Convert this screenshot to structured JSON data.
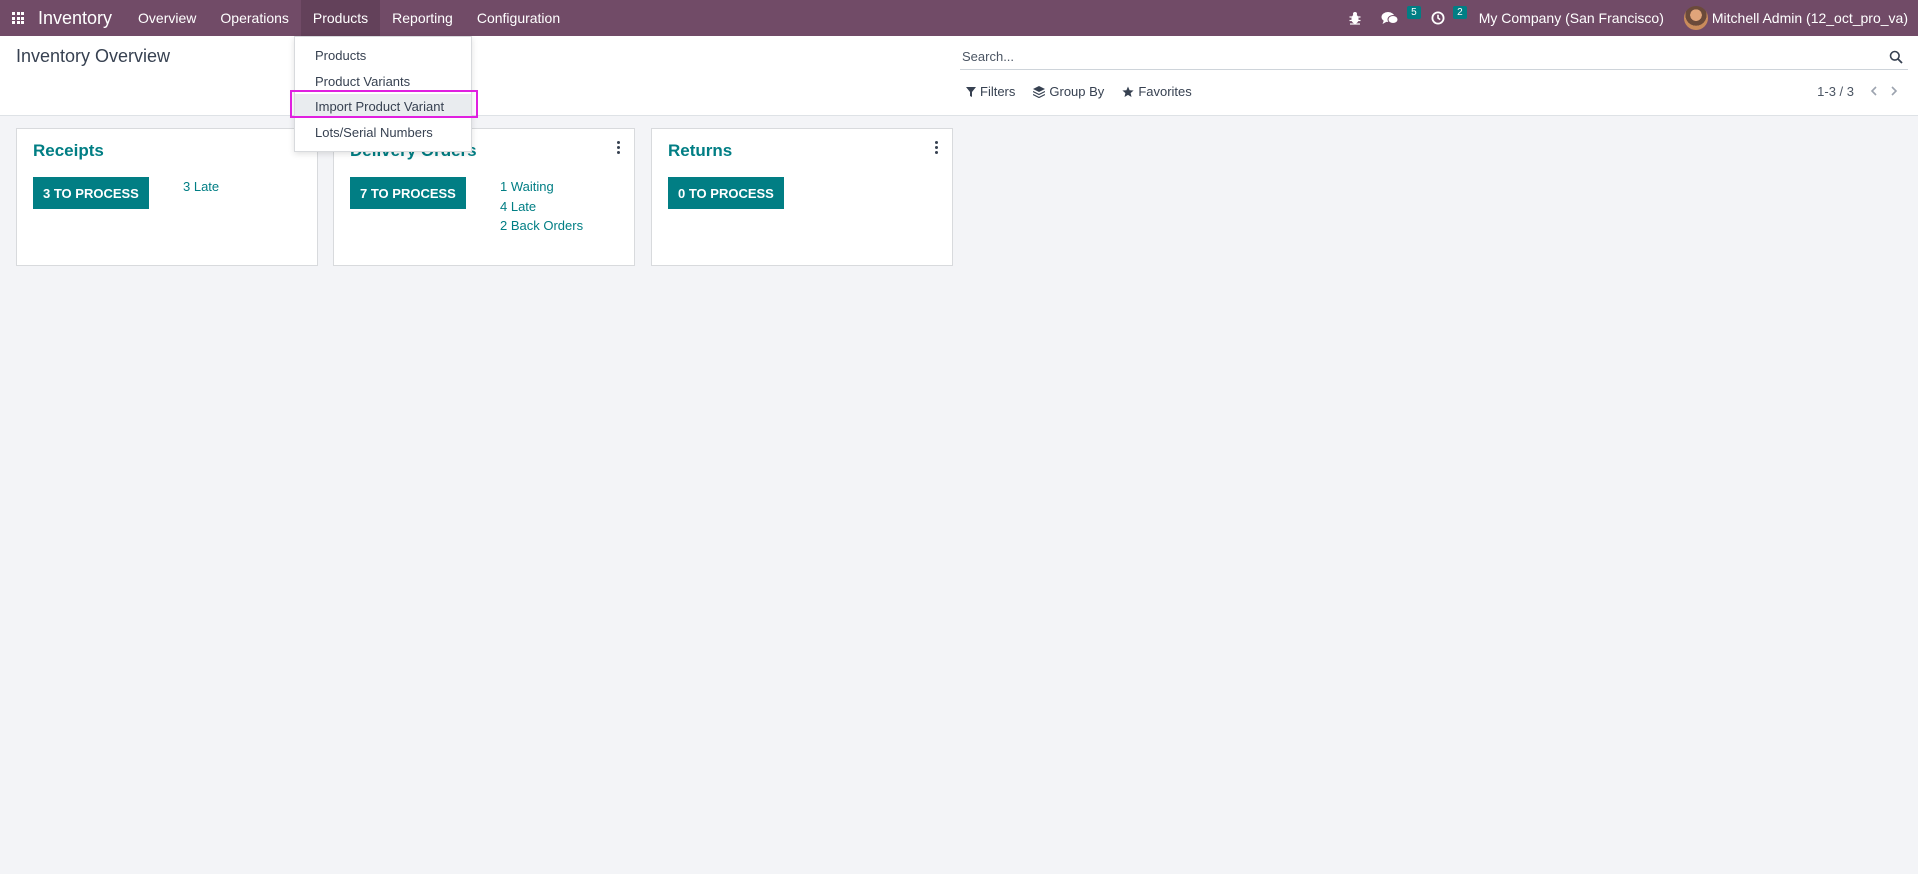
{
  "navbar": {
    "app_name": "Inventory",
    "menu": [
      "Overview",
      "Operations",
      "Products",
      "Reporting",
      "Configuration"
    ],
    "messages_count": "5",
    "activities_count": "2",
    "company": "My Company (San Francisco)",
    "user": "Mitchell Admin (12_oct_pro_va)",
    "accent_color": "#714b67"
  },
  "control_panel": {
    "title": "Inventory Overview",
    "search_placeholder": "Search...",
    "filters_label": "Filters",
    "groupby_label": "Group By",
    "favorites_label": "Favorites",
    "pager": "1-3 / 3"
  },
  "products_menu": {
    "items": [
      "Products",
      "Product Variants",
      "Import Product Variant",
      "Lots/Serial Numbers"
    ],
    "highlighted": "Import Product Variant"
  },
  "cards": [
    {
      "title": "Receipts",
      "button": "3 TO PROCESS",
      "links": [
        "3 Late"
      ]
    },
    {
      "title": "Delivery Orders",
      "button": "7 TO PROCESS",
      "links": [
        "1 Waiting",
        "4 Late",
        "2 Back Orders"
      ]
    },
    {
      "title": "Returns",
      "button": "0 TO PROCESS",
      "links": []
    }
  ],
  "colors": {
    "primary": "#017e84",
    "highlight": "#e020e0"
  }
}
